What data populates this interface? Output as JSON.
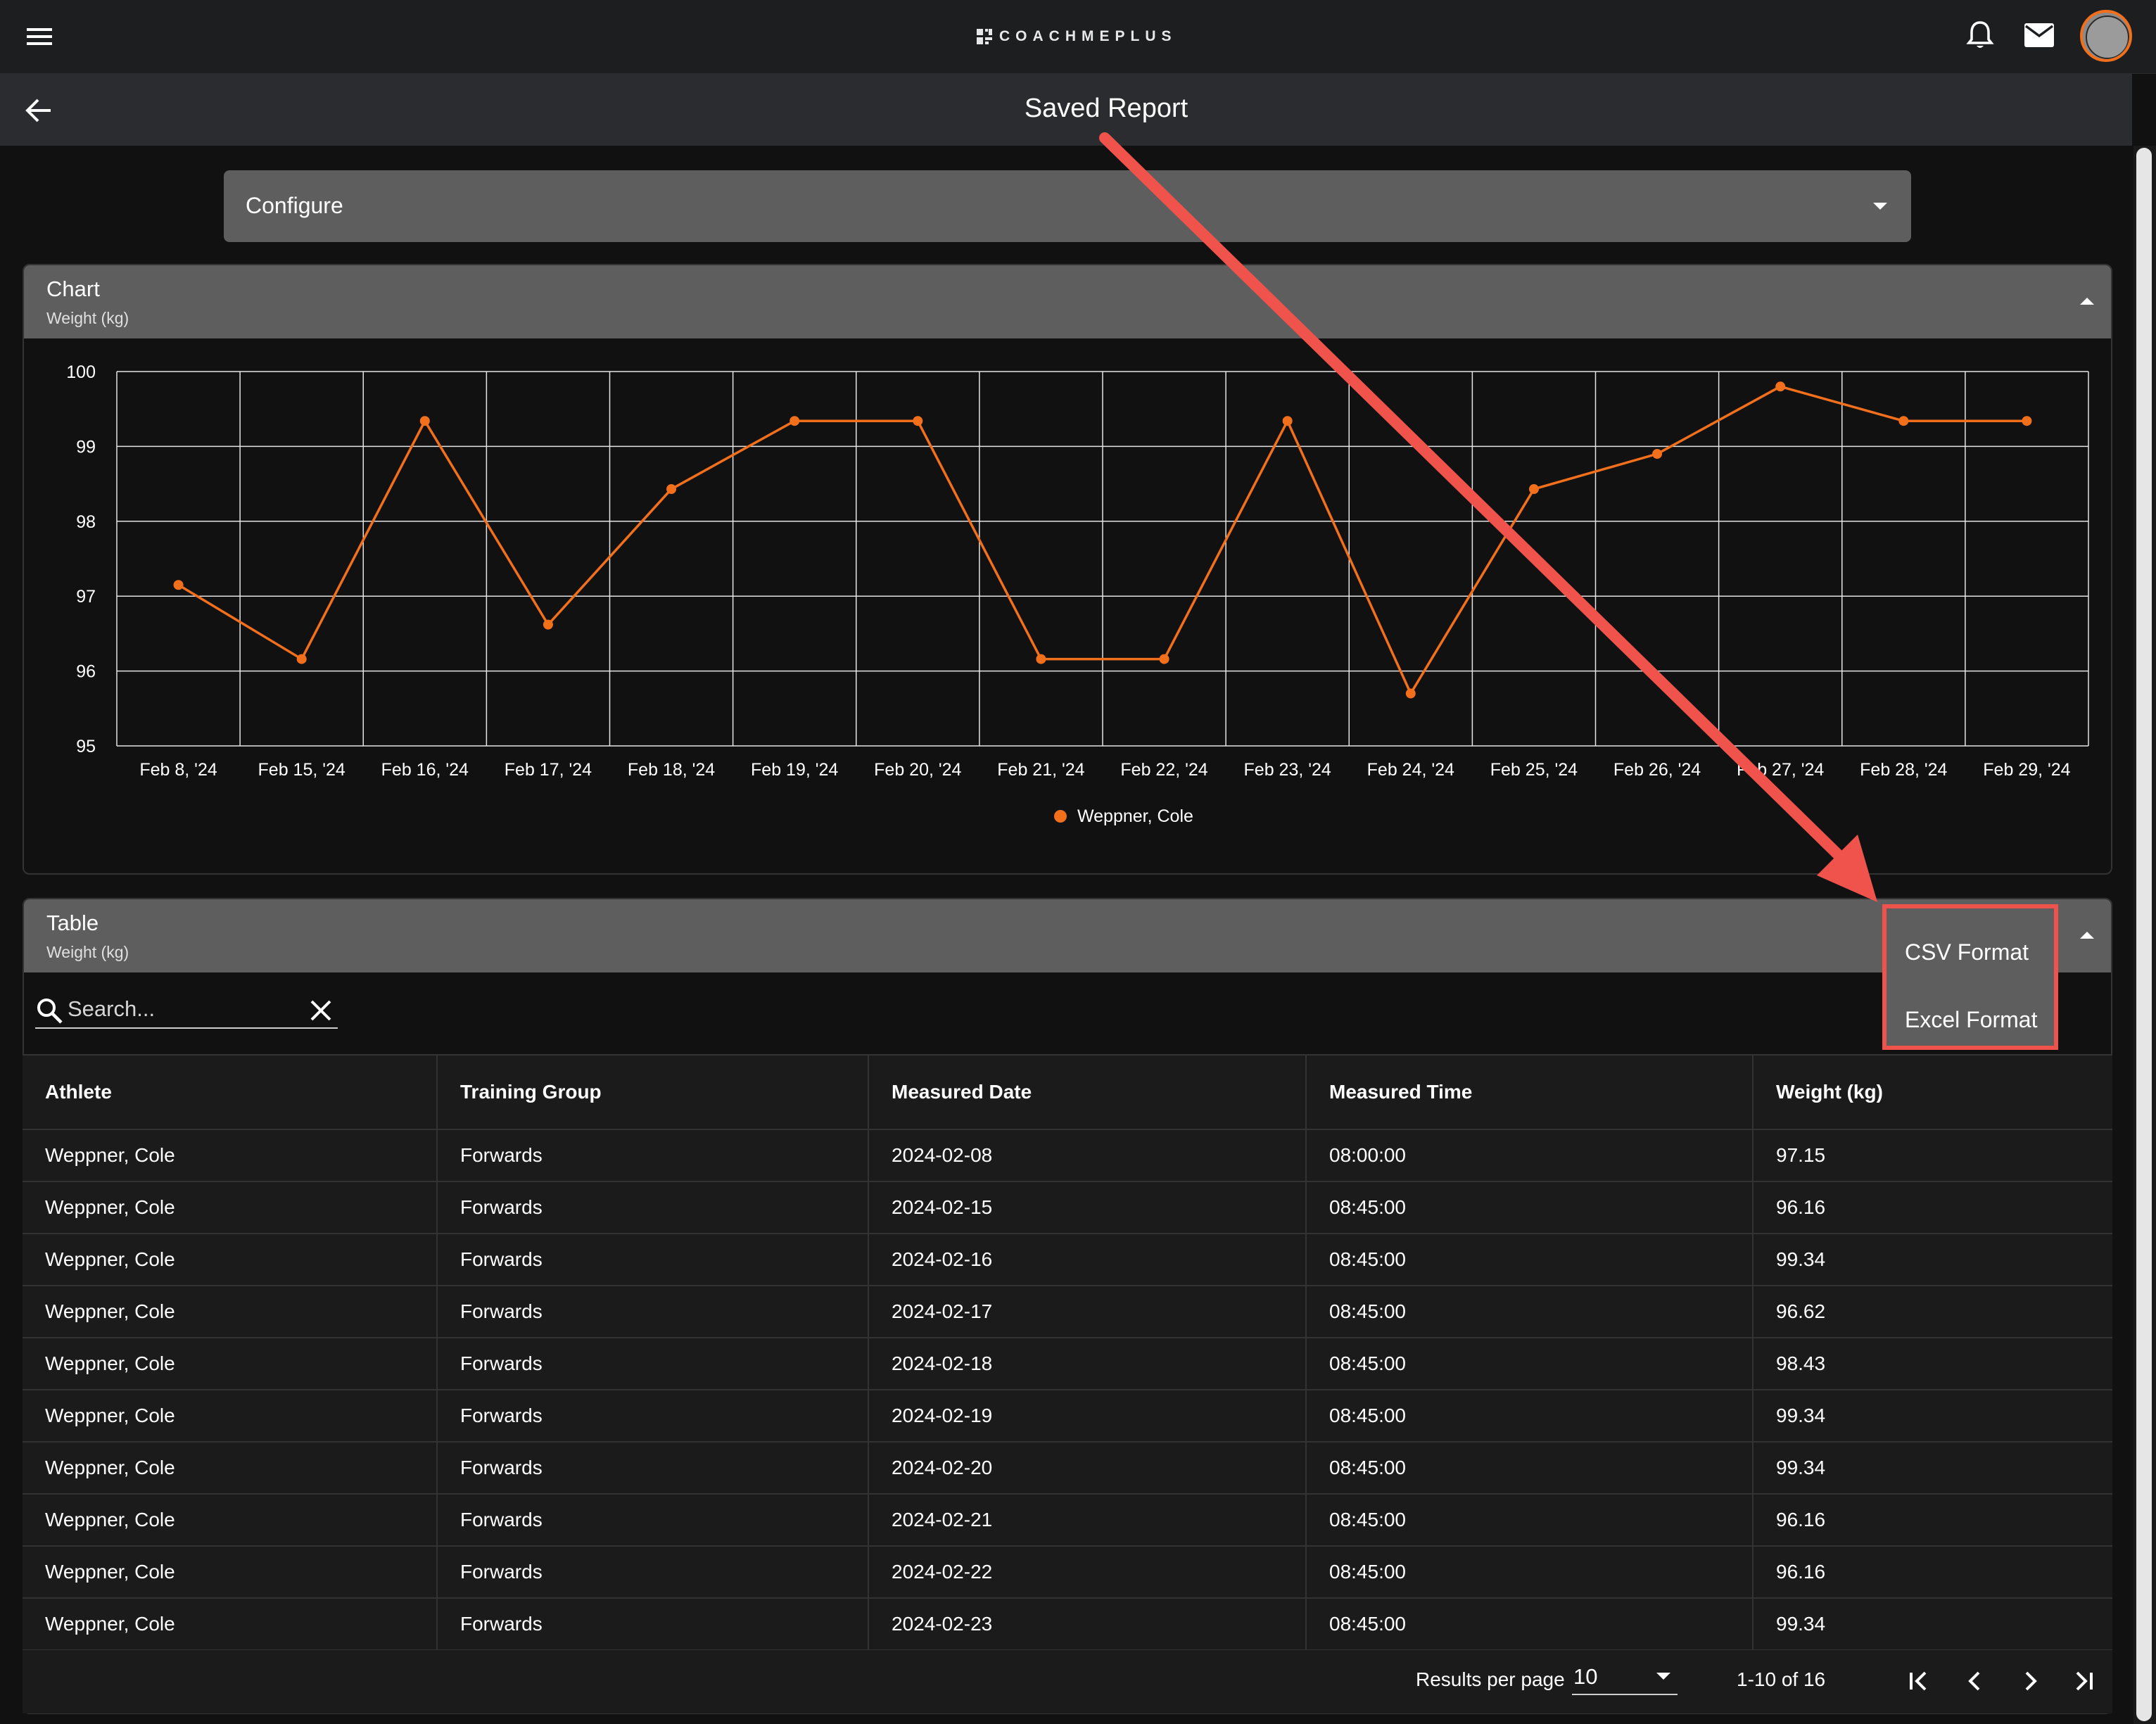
{
  "app": {
    "brand": "COACHMEPLUS",
    "page_title": "Saved Report",
    "icons": [
      "menu-icon",
      "bell-icon",
      "mail-icon",
      "avatar",
      "back-arrow-icon"
    ]
  },
  "configure": {
    "label": "Configure"
  },
  "chart_panel": {
    "title": "Chart",
    "subtitle": "Weight (kg)"
  },
  "chart_data": {
    "type": "line",
    "title": "",
    "xlabel": "",
    "ylabel": "",
    "categories": [
      "Feb 8, '24",
      "Feb 15, '24",
      "Feb 16, '24",
      "Feb 17, '24",
      "Feb 18, '24",
      "Feb 19, '24",
      "Feb 20, '24",
      "Feb 21, '24",
      "Feb 22, '24",
      "Feb 23, '24",
      "Feb 24, '24",
      "Feb 25, '24",
      "Feb 26, '24",
      "Feb 27, '24",
      "Feb 28, '24",
      "Feb 29, '24"
    ],
    "series": [
      {
        "name": "Weppner, Cole",
        "color": "#f26f1c",
        "values": [
          97.15,
          96.16,
          99.34,
          96.62,
          98.43,
          99.34,
          99.34,
          96.16,
          96.16,
          99.34,
          95.7,
          98.43,
          98.9,
          99.8,
          99.34,
          99.34
        ]
      }
    ],
    "ylim": [
      95,
      100
    ],
    "yticks": [
      "95",
      "96",
      "97",
      "98",
      "99",
      "100"
    ],
    "grid": true,
    "legend": "bottom-center"
  },
  "table_panel": {
    "title": "Table",
    "subtitle": "Weight (kg)"
  },
  "search": {
    "placeholder": "Search...",
    "value": ""
  },
  "export_menu": {
    "items": [
      "CSV Format",
      "Excel Format"
    ],
    "border_color": "#f0534b"
  },
  "table": {
    "columns": [
      "Athlete",
      "Training Group",
      "Measured Date",
      "Measured Time",
      "Weight (kg)"
    ],
    "rows": [
      [
        "Weppner, Cole",
        "Forwards",
        "2024-02-08",
        "08:00:00",
        "97.15"
      ],
      [
        "Weppner, Cole",
        "Forwards",
        "2024-02-15",
        "08:45:00",
        "96.16"
      ],
      [
        "Weppner, Cole",
        "Forwards",
        "2024-02-16",
        "08:45:00",
        "99.34"
      ],
      [
        "Weppner, Cole",
        "Forwards",
        "2024-02-17",
        "08:45:00",
        "96.62"
      ],
      [
        "Weppner, Cole",
        "Forwards",
        "2024-02-18",
        "08:45:00",
        "98.43"
      ],
      [
        "Weppner, Cole",
        "Forwards",
        "2024-02-19",
        "08:45:00",
        "99.34"
      ],
      [
        "Weppner, Cole",
        "Forwards",
        "2024-02-20",
        "08:45:00",
        "99.34"
      ],
      [
        "Weppner, Cole",
        "Forwards",
        "2024-02-21",
        "08:45:00",
        "96.16"
      ],
      [
        "Weppner, Cole",
        "Forwards",
        "2024-02-22",
        "08:45:00",
        "96.16"
      ],
      [
        "Weppner, Cole",
        "Forwards",
        "2024-02-23",
        "08:45:00",
        "99.34"
      ]
    ]
  },
  "pagination": {
    "results_per_page_label": "Results per page",
    "results_per_page_value": "10",
    "range": "1-10 of 16"
  },
  "colors": {
    "accent": "#f26f1c",
    "annotation": "#f0534b",
    "panel_header": "#5e5e5e",
    "background": "#111111"
  }
}
